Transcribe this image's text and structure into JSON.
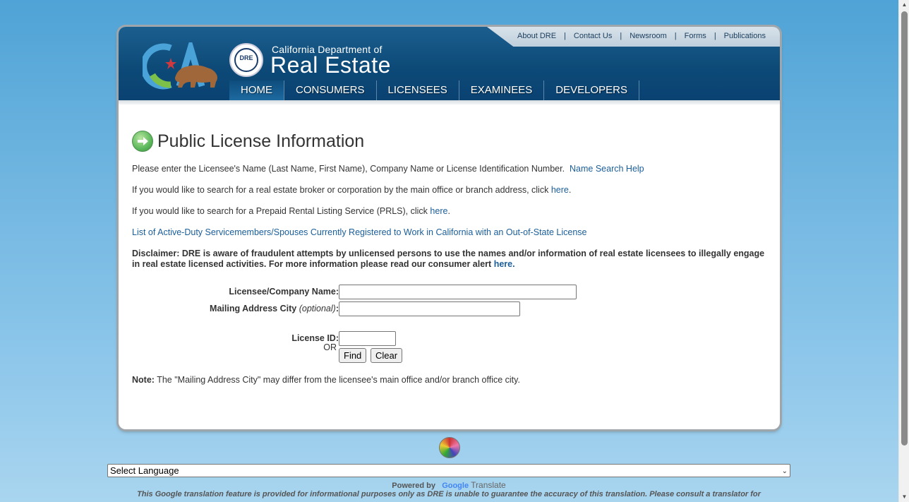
{
  "header": {
    "top_links": [
      "About DRE",
      "Contact Us",
      "Newsroom",
      "Forms",
      "Publications"
    ],
    "seal_text": "DRE",
    "dept_line1": "California Department of",
    "dept_line2": "Real Estate",
    "nav": [
      "HOME",
      "CONSUMERS",
      "LICENSEES",
      "EXAMINEES",
      "DEVELOPERS"
    ],
    "nav_active": "HOME"
  },
  "main": {
    "title": "Public License Information",
    "intro": "Please enter the Licensee's Name (Last Name, First Name), Company Name or License Identification Number.",
    "name_search_help": "Name Search Help",
    "broker_text": "If you would like to search for a real estate broker or corporation by the main office or branch address, click",
    "broker_link": "here",
    "prls_text": "If you would like to search for a Prepaid Rental Listing Service (PRLS), click",
    "prls_link": "here",
    "servicemembers_link": "List of Active-Duty Servicemembers/Spouses Currently Registered to Work in California with an Out-of-State License",
    "disclaimer_text": "Disclaimer: DRE is aware of fraudulent attempts by unlicensed persons to use the names and/or information of real estate licensees to illegally engage in real estate licensed activities. For more information please read our consumer alert",
    "disclaimer_link": "here."
  },
  "form": {
    "name_label": "Licensee/Company Name:",
    "name_value": "",
    "city_label": "Mailing Address City",
    "city_optional": "(optional)",
    "city_value": "",
    "or_label": "OR",
    "license_label": "License ID:",
    "license_value": "",
    "find_label": "Find",
    "clear_label": "Clear"
  },
  "note": {
    "label": "Note:",
    "text": "The \"Mailing Address City\" may differ from the licensee's main office and/or branch office city."
  },
  "footer": {
    "language_select": "Select Language",
    "powered_by": "Powered by",
    "google": "Google",
    "translate": "Translate",
    "translate_note": "This Google translation feature is provided for informational purposes only as DRE is unable to guarantee the accuracy of this translation. Please consult a translator for"
  },
  "colors": {
    "header_blue": "#0d4a78",
    "link_blue": "#1a5e9a",
    "background_sky": "#6fb5e0"
  }
}
